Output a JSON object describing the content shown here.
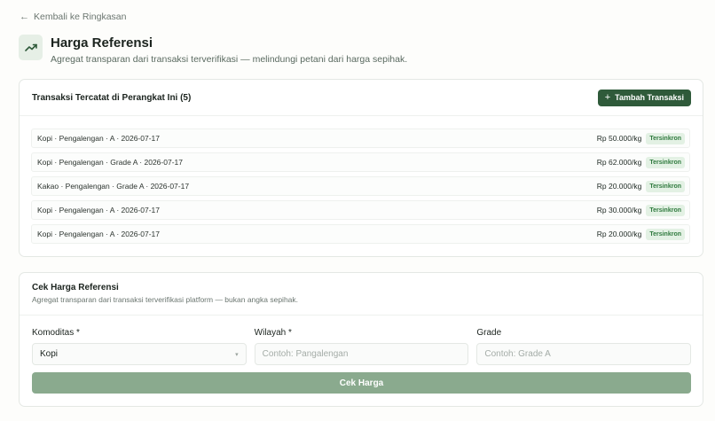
{
  "nav": {
    "back_label": "Kembali ke Ringkasan"
  },
  "header": {
    "icon": "trending-up-icon",
    "title": "Harga Referensi",
    "subtitle": "Agregat transparan dari transaksi terverifikasi — melindungi petani dari harga sepihak."
  },
  "transactions": {
    "title": "Transaksi Tercatat di Perangkat Ini (5)",
    "add_button": "Tambah Transaksi",
    "rows": [
      {
        "desc": "Kopi · Pengalengan · A · 2026-07-17",
        "price": "Rp 50.000/kg",
        "status": "Tersinkron"
      },
      {
        "desc": "Kopi · Pengalengan · Grade A · 2026-07-17",
        "price": "Rp 62.000/kg",
        "status": "Tersinkron"
      },
      {
        "desc": "Kakao · Pengalengan · Grade A · 2026-07-17",
        "price": "Rp 20.000/kg",
        "status": "Tersinkron"
      },
      {
        "desc": "Kopi · Pengalengan · A · 2026-07-17",
        "price": "Rp 30.000/kg",
        "status": "Tersinkron"
      },
      {
        "desc": "Kopi · Pengalengan · A · 2026-07-17",
        "price": "Rp 20.000/kg",
        "status": "Tersinkron"
      }
    ]
  },
  "check_price": {
    "title": "Cek Harga Referensi",
    "subtitle": "Agregat transparan dari transaksi terverifikasi platform — bukan angka sepihak.",
    "commodity": {
      "label": "Komoditas *",
      "value": "Kopi"
    },
    "region": {
      "label": "Wilayah *",
      "placeholder": "Contoh: Pangalengan"
    },
    "grade": {
      "label": "Grade",
      "placeholder": "Contoh: Grade A"
    },
    "submit": "Cek Harga"
  },
  "colors": {
    "primary": "#2f5a3a",
    "badge_bg": "#e3f1e4",
    "badge_text": "#2f7a3e",
    "submit_disabled": "#8aaa8e"
  }
}
